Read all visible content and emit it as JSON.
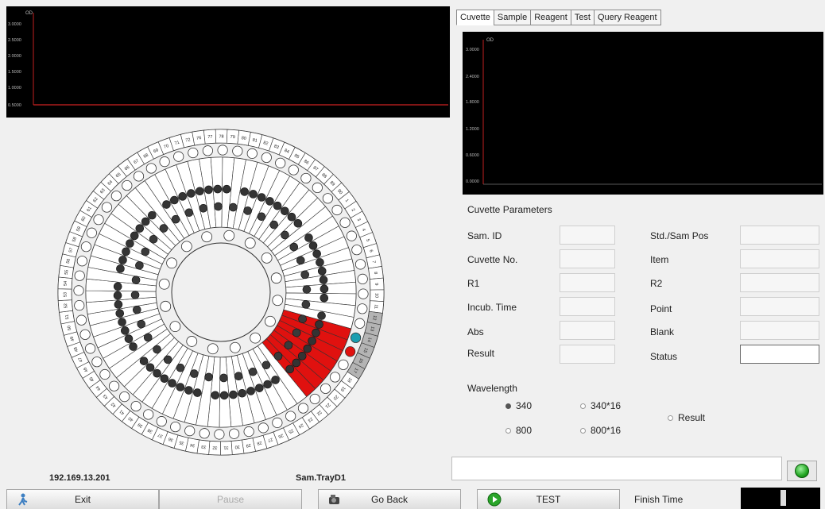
{
  "top_chart": {
    "axis_label": "OD",
    "y_ticks": [
      "3.0000",
      "2.5000",
      "2.0000",
      "1.5000",
      "1.0000",
      "0.5000"
    ]
  },
  "tabs": [
    {
      "label": "Cuvette",
      "active": true
    },
    {
      "label": "Sample",
      "active": false
    },
    {
      "label": "Reagent",
      "active": false
    },
    {
      "label": "Test",
      "active": false
    },
    {
      "label": "Query Reagent",
      "active": false
    }
  ],
  "right_chart": {
    "axis_label": "OD",
    "y_ticks": [
      "3.0000",
      "2.4000",
      "1.8000",
      "1.2000",
      "0.6000",
      "0.0000"
    ]
  },
  "params": {
    "title": "Cuvette Parameters",
    "left_labels": [
      "Sam. ID",
      "Cuvette No.",
      "R1",
      "Incub. Time",
      "Abs",
      "Result"
    ],
    "right_labels": [
      "Std./Sam Pos",
      "Item",
      "R2",
      "Point",
      "Blank",
      "Status"
    ]
  },
  "wavelength": {
    "title": "Wavelength",
    "options": [
      {
        "label": "340",
        "selected": true
      },
      {
        "label": "340*16",
        "selected": false
      },
      {
        "label": "800",
        "selected": false
      },
      {
        "label": "800*16",
        "selected": false
      },
      {
        "label": "Result",
        "selected": false
      }
    ]
  },
  "tray": {
    "ip": "192.169.13.201",
    "name": "Sam.TrayD1",
    "outer_ring_numbers": [
      "72",
      "76",
      "77",
      "78",
      "79",
      "80",
      "81",
      "82",
      "83",
      "84",
      "85",
      "86",
      "87",
      "88",
      "89",
      "90",
      "1",
      "2",
      "3",
      "4",
      "5",
      "6",
      "7",
      "8",
      "9",
      "10",
      "11",
      "12",
      "13",
      "14",
      "15",
      "16",
      "17",
      "18",
      "19",
      "20",
      "21",
      "22",
      "23",
      "24",
      "25",
      "26",
      "27",
      "28",
      "29",
      "30",
      "31",
      "32",
      "33",
      "34",
      "35",
      "36",
      "37",
      "38",
      "39",
      "40",
      "41",
      "42",
      "43",
      "44",
      "45",
      "46",
      "47",
      "48",
      "49",
      "50",
      "51",
      "52",
      "53",
      "54",
      "55",
      "56",
      "57",
      "58",
      "59",
      "60",
      "61",
      "62",
      "63",
      "64",
      "65",
      "66",
      "67",
      "68",
      "69",
      "70",
      "71"
    ],
    "highlight_red": "#e0110f",
    "highlight_teal": "#1a9eb0"
  },
  "buttons": {
    "exit": "Exit",
    "pause": "Pause",
    "go_back": "Go Back",
    "test": "TEST"
  },
  "finish_time_label": "Finish Time",
  "colors": {
    "chart_bg": "#000000",
    "baseline_red": "#cc2222",
    "axis_red": "#c02020"
  }
}
